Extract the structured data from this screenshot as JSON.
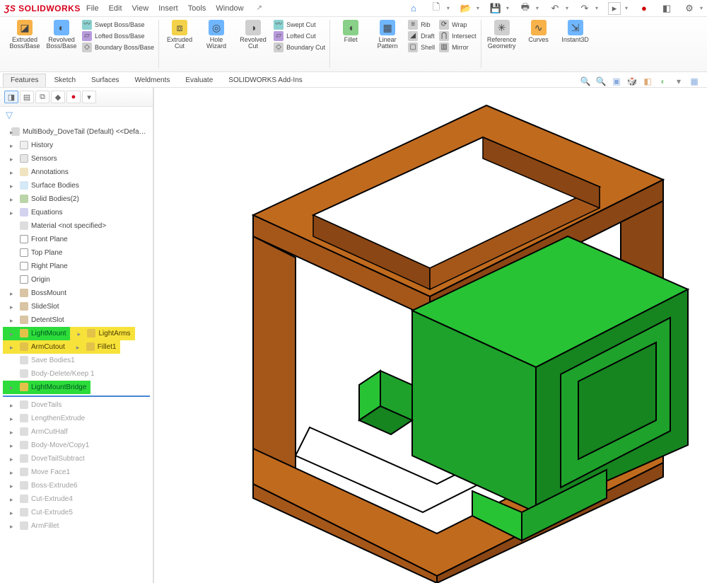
{
  "app": {
    "logo_a": "SOLID",
    "logo_b": "WORKS"
  },
  "menu": [
    "File",
    "Edit",
    "View",
    "Insert",
    "Tools",
    "Window"
  ],
  "titlebar_icons": [
    "home",
    "new",
    "open",
    "save",
    "print",
    "undo",
    "redo",
    "play",
    "record",
    "settings",
    "search"
  ],
  "ribbon": {
    "g1": {
      "big": [
        {
          "label": "Extruded Boss/Base"
        },
        {
          "label": "Revolved Boss/Base"
        }
      ],
      "minis": [
        "Swept Boss/Base",
        "Lofted Boss/Base",
        "Boundary Boss/Base"
      ]
    },
    "g2": {
      "big": [
        {
          "label": "Extruded Cut"
        },
        {
          "label": "Hole Wizard"
        },
        {
          "label": "Revolved Cut"
        }
      ],
      "minis": [
        "Swept Cut",
        "Lofted Cut",
        "Boundary Cut"
      ]
    },
    "g3": {
      "big": [
        {
          "label": "Fillet"
        },
        {
          "label": "Linear Pattern"
        }
      ],
      "minis": [
        "Rib",
        "Draft",
        "Shell",
        "Wrap",
        "Intersect",
        "Mirror"
      ]
    },
    "g4": {
      "big": [
        {
          "label": "Reference Geometry"
        },
        {
          "label": "Curves"
        },
        {
          "label": "Instant3D"
        }
      ]
    }
  },
  "tabs": [
    "Features",
    "Sketch",
    "Surfaces",
    "Weldments",
    "Evaluate",
    "SOLIDWORKS Add-Ins"
  ],
  "tree_root": "MultiBody_DoveTail (Default) <<Defa…",
  "tree": [
    {
      "label": "History",
      "icon": "ni-hist"
    },
    {
      "label": "Sensors",
      "icon": "ni-sens"
    },
    {
      "label": "Annotations",
      "icon": "ni-ann"
    },
    {
      "label": "Surface Bodies",
      "icon": "ni-surf"
    },
    {
      "label": "Solid Bodies(2)",
      "icon": "ni-solid"
    },
    {
      "label": "Equations",
      "icon": "ni-eq"
    },
    {
      "label": "Material <not specified>",
      "icon": "ni-mat",
      "leaf": true
    },
    {
      "label": "Front Plane",
      "icon": "ni-plane",
      "leaf": true
    },
    {
      "label": "Top Plane",
      "icon": "ni-plane",
      "leaf": true
    },
    {
      "label": "Right Plane",
      "icon": "ni-plane",
      "leaf": true
    },
    {
      "label": "Origin",
      "icon": "ni-orig",
      "leaf": true
    },
    {
      "label": "BossMount",
      "icon": "ni-feat"
    },
    {
      "label": "SlideSlot",
      "icon": "ni-feat"
    },
    {
      "label": "DetentSlot",
      "icon": "ni-feat"
    },
    {
      "label": "LightMount",
      "icon": "ni-gold",
      "hl": "green"
    },
    {
      "label": "LightArms",
      "icon": "ni-gold",
      "hl": "yellow"
    },
    {
      "label": "ArmCutout",
      "icon": "ni-gold",
      "hl": "yellow"
    },
    {
      "label": "Fillet1",
      "icon": "ni-gold",
      "hl": "yellow"
    },
    {
      "label": "Save Bodies1",
      "icon": "ni-gray",
      "leaf": true,
      "dim": true
    },
    {
      "label": "Body-Delete/Keep 1",
      "icon": "ni-gray",
      "leaf": true,
      "dim": true
    },
    {
      "label": "LightMountBridge",
      "icon": "ni-gold",
      "hl": "green"
    }
  ],
  "tree_after_rollback": [
    {
      "label": "DoveTails",
      "icon": "ni-gray",
      "dim": true
    },
    {
      "label": "LengthenExtrude",
      "icon": "ni-gray",
      "dim": true
    },
    {
      "label": "ArmCutHalf",
      "icon": "ni-gray",
      "dim": true
    },
    {
      "label": "Body-Move/Copy1",
      "icon": "ni-gray",
      "dim": true
    },
    {
      "label": "DoveTailSubtract",
      "icon": "ni-gray",
      "dim": true
    },
    {
      "label": "Move Face1",
      "icon": "ni-gray",
      "dim": true
    },
    {
      "label": "Boss-Extrude6",
      "icon": "ni-gray",
      "dim": true
    },
    {
      "label": "Cut-Extrude4",
      "icon": "ni-gray",
      "dim": true
    },
    {
      "label": "Cut-Extrude5",
      "icon": "ni-gray",
      "dim": true
    },
    {
      "label": "ArmFillet",
      "icon": "ni-gray",
      "dim": true
    }
  ],
  "colors": {
    "brown_top": "#c06a1e",
    "brown_side": "#a5571a",
    "brown_dark": "#8a4614",
    "green_top": "#27c335",
    "green_side": "#1ea22b",
    "green_dark": "#168520"
  }
}
